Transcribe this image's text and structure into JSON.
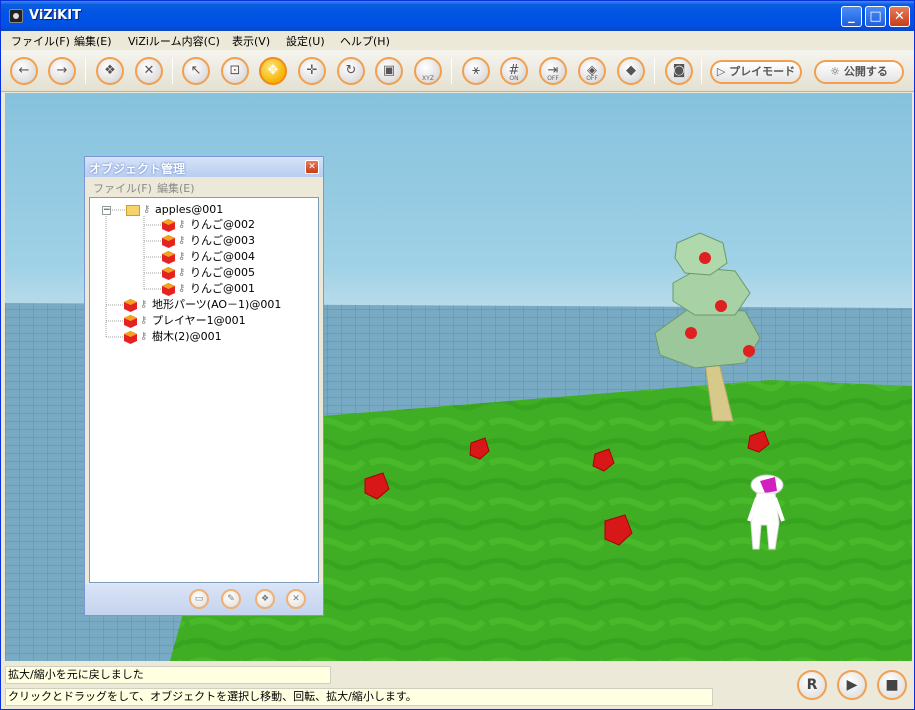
{
  "window": {
    "title": "ViZiKIT",
    "minimize": "_",
    "maximize": "□",
    "close": "✕"
  },
  "menu": [
    {
      "label": "ファイル(F)"
    },
    {
      "label": "編集(E)"
    },
    {
      "label": "ViZiルーム内容(C)"
    },
    {
      "label": "表示(V)"
    },
    {
      "label": "設定(U)"
    },
    {
      "label": "ヘルプ(H)"
    }
  ],
  "toolbar": {
    "buttons": [
      {
        "icon": "back-icon",
        "glyph": "←"
      },
      {
        "icon": "forward-icon",
        "glyph": "→"
      },
      {
        "icon": "objects-icon",
        "glyph": "❖"
      },
      {
        "icon": "delete-icon",
        "glyph": "✕"
      },
      {
        "icon": "select-icon",
        "glyph": "↖"
      },
      {
        "icon": "hierarchy-icon",
        "glyph": "⊡"
      },
      {
        "icon": "move-target-icon",
        "glyph": "✥"
      },
      {
        "icon": "move-icon",
        "glyph": "✛"
      },
      {
        "icon": "rotate-icon",
        "glyph": "↻"
      },
      {
        "icon": "scale-icon",
        "glyph": "▣"
      },
      {
        "icon": "xyz-icon",
        "glyph": "",
        "sub": "XYZ"
      },
      {
        "icon": "axes-icon",
        "glyph": "⚹"
      },
      {
        "icon": "grid-on-icon",
        "glyph": "#",
        "sub": "ON"
      },
      {
        "icon": "snap-off-icon",
        "glyph": "⇥",
        "sub": "OFF"
      },
      {
        "icon": "box-off-icon",
        "glyph": "◈",
        "sub": "OFF"
      },
      {
        "icon": "camera-view-icon",
        "glyph": "◆"
      },
      {
        "icon": "screenshot-icon",
        "glyph": "◙"
      }
    ],
    "play_mode_label": "▷ プレイモード",
    "publish_label": "☼ 公開する"
  },
  "object_panel": {
    "title": "オブジェクト管理",
    "close": "✕",
    "menu": [
      "ファイル(F)",
      "編集(E)"
    ],
    "tree": [
      {
        "label": "apples@001",
        "type": "folder",
        "level": 0,
        "expanded": true
      },
      {
        "label": "りんご@002",
        "type": "object",
        "level": 1
      },
      {
        "label": "りんご@003",
        "type": "object",
        "level": 1
      },
      {
        "label": "りんご@004",
        "type": "object",
        "level": 1
      },
      {
        "label": "りんご@005",
        "type": "object",
        "level": 1
      },
      {
        "label": "りんご@001",
        "type": "object",
        "level": 1
      },
      {
        "label": "地形パーツ(AO－1)@001",
        "type": "object",
        "level": 0
      },
      {
        "label": "プレイヤー1@001",
        "type": "object",
        "level": 0
      },
      {
        "label": "樹木(2)@001",
        "type": "object",
        "level": 0
      }
    ],
    "toggle": "−",
    "bottom_buttons": [
      {
        "icon": "new-folder-icon",
        "glyph": "▭"
      },
      {
        "icon": "rename-icon",
        "glyph": "✎"
      },
      {
        "icon": "add-object-icon",
        "glyph": "❖"
      },
      {
        "icon": "remove-icon",
        "glyph": "✕"
      }
    ]
  },
  "status": {
    "message": "拡大/縮小を元に戻しました",
    "hint": "クリックとドラッグをして、オブジェクトを選択し移動、回転、拡大/縮小します。"
  },
  "controls": {
    "reset": "R",
    "play": "▶",
    "stop": "■"
  },
  "colors": {
    "grass": "#3fae24",
    "sky": "#9fd1e6",
    "accent": "#f0a050",
    "titlebar": "#0054e3"
  }
}
